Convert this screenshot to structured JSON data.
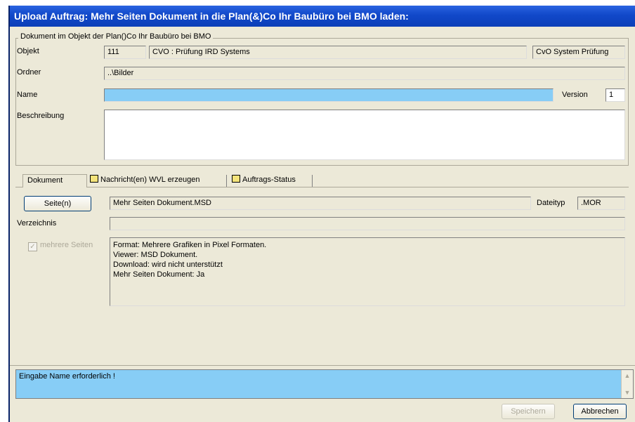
{
  "window": {
    "title": "Upload Auftrag: Mehr Seiten Dokument in die Plan(&)Co Ihr Baubüro bei BMO laden:"
  },
  "group": {
    "legend": "Dokument im Objekt der Plan()Co Ihr Baubüro bei BMO",
    "objekt_label": "Objekt",
    "objekt_nr": "111",
    "objekt_name": "CVO : Prüfung IRD Systems",
    "objekt_extra": "CvO System Prüfung",
    "ordner_label": "Ordner",
    "ordner_value": "..\\Bilder",
    "name_label": "Name",
    "name_value": "",
    "version_label": "Version",
    "version_value": "1",
    "beschreibung_label": "Beschreibung",
    "beschreibung_value": ""
  },
  "tabs": [
    {
      "label": "Dokument"
    },
    {
      "label": "Nachricht(en) WVL erzeugen"
    },
    {
      "label": "Auftrags-Status"
    }
  ],
  "dokument_tab": {
    "seiten_button": "Seite(n)",
    "file_name": "Mehr Seiten Dokument.MSD",
    "dateityp_label": "Dateityp",
    "dateityp_value": ".MOR",
    "verzeichnis_label": "Verzeichnis",
    "verzeichnis_value": "",
    "mehrere_seiten_label": "mehrere Seiten",
    "mehrere_seiten_checked": true,
    "info_lines": [
      "Format: Mehrere Grafiken in Pixel Formaten.",
      "Viewer: MSD Dokument.",
      "Download: wird nicht unterstützt",
      "Mehr Seiten Dokument: Ja"
    ]
  },
  "status": {
    "message": "Eingabe Name erforderlich !"
  },
  "buttons": {
    "speichern": "Speichern",
    "abbrechen": "Abbrechen"
  }
}
